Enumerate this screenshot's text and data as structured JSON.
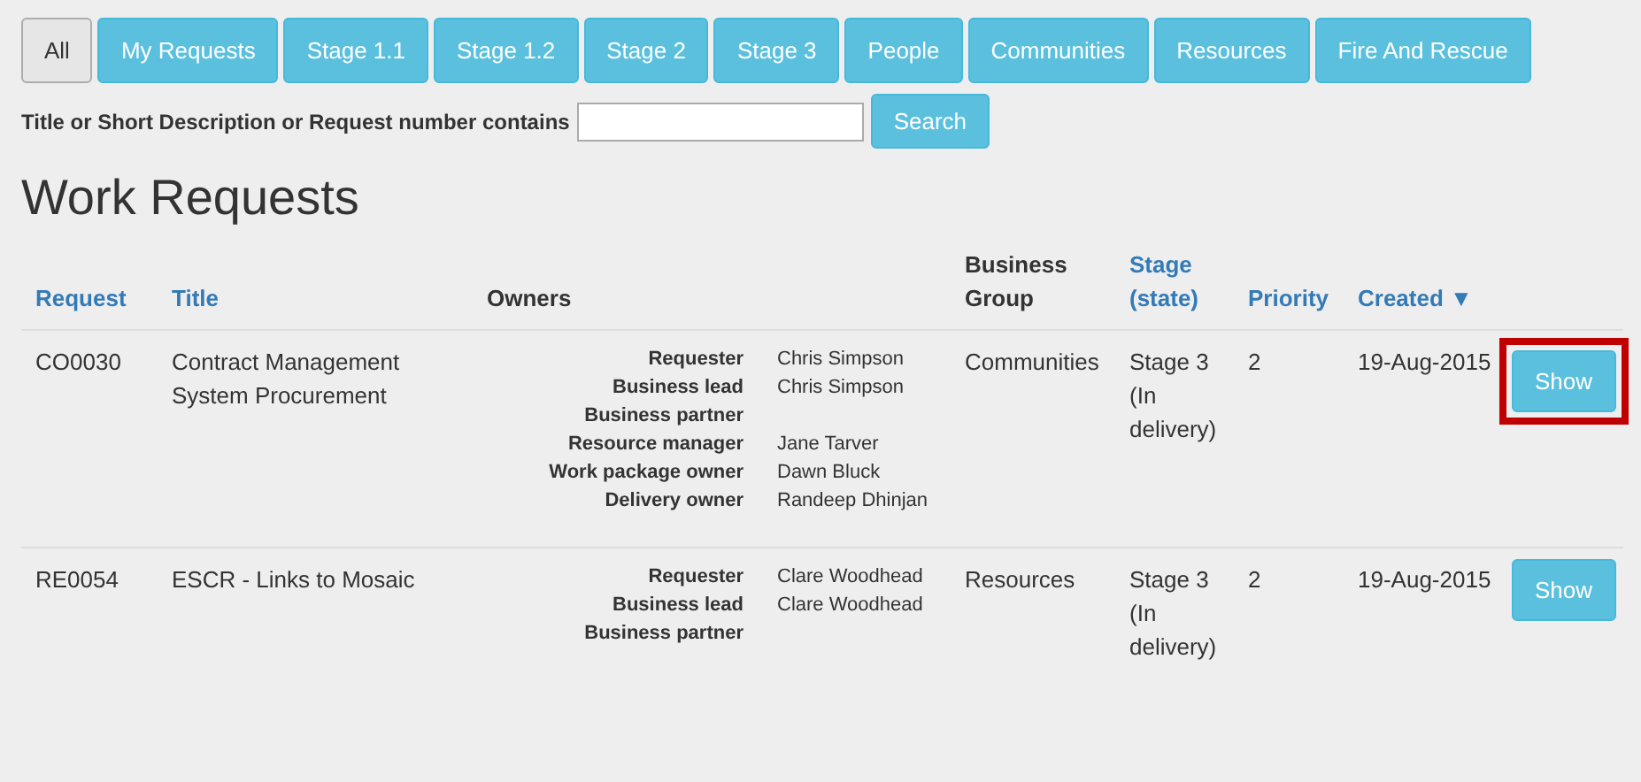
{
  "tabs": [
    {
      "label": "All",
      "selected": true
    },
    {
      "label": "My Requests",
      "selected": false
    },
    {
      "label": "Stage 1.1",
      "selected": false
    },
    {
      "label": "Stage 1.2",
      "selected": false
    },
    {
      "label": "Stage 2",
      "selected": false
    },
    {
      "label": "Stage 3",
      "selected": false
    },
    {
      "label": "People",
      "selected": false
    },
    {
      "label": "Communities",
      "selected": false
    },
    {
      "label": "Resources",
      "selected": false
    },
    {
      "label": "Fire And Rescue",
      "selected": false
    }
  ],
  "search": {
    "label": "Title or Short Description or Request number contains",
    "button": "Search"
  },
  "heading": "Work Requests",
  "table": {
    "columns": [
      {
        "label": "Request",
        "kind": "link"
      },
      {
        "label": "Title",
        "kind": "link"
      },
      {
        "label": "Owners",
        "kind": "plain"
      },
      {
        "label": "Business Group",
        "kind": "plain"
      },
      {
        "label": "Stage (state)",
        "kind": "link"
      },
      {
        "label": "Priority",
        "kind": "link"
      },
      {
        "label": "Created ▼",
        "kind": "link"
      }
    ],
    "rows": [
      {
        "request": "CO0030",
        "title": "Contract Management System Procurement",
        "owners": [
          {
            "role": "Requester",
            "name": "Chris Simpson"
          },
          {
            "role": "Business lead",
            "name": "Chris Simpson"
          },
          {
            "role": "Business partner"
          },
          {
            "role": "Resource manager",
            "name": "Jane Tarver"
          },
          {
            "role": "Work package owner",
            "name": "Dawn Bluck"
          },
          {
            "role": "Delivery owner",
            "name": "Randeep Dhinjan"
          }
        ],
        "group": "Communities",
        "stage": "Stage 3 (In delivery)",
        "priority": "2",
        "created": "19-Aug-2015",
        "button": "Show",
        "highlighted": true
      },
      {
        "request": "RE0054",
        "title": "ESCR - Links to Mosaic",
        "owners": [
          {
            "role": "Requester",
            "name": "Clare Woodhead"
          },
          {
            "role": "Business lead",
            "name": "Clare Woodhead"
          },
          {
            "role": "Business partner"
          }
        ],
        "group": "Resources",
        "stage": "Stage 3 (In delivery)",
        "priority": "2",
        "created": "19-Aug-2015",
        "button": "Show",
        "highlighted": false
      }
    ]
  }
}
